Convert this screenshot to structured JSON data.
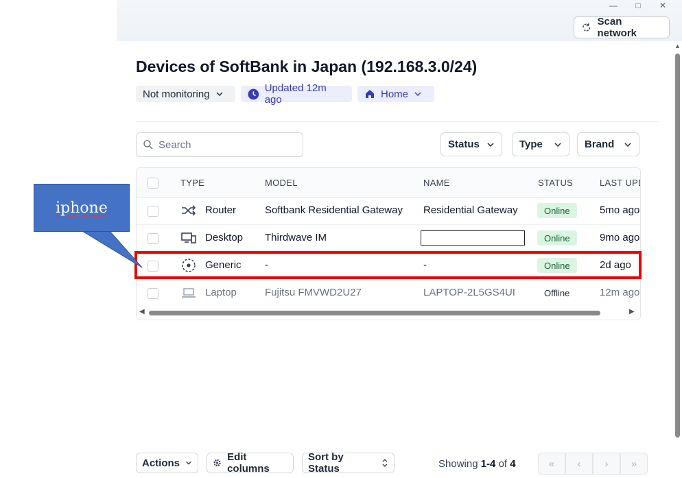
{
  "window": {
    "minimize_glyph": "—",
    "maximize_glyph": "□",
    "close_glyph": "✕"
  },
  "header": {
    "scan_button": "Scan network"
  },
  "page": {
    "title": "Devices of SoftBank in Japan (192.168.3.0/24)",
    "monitoring": "Not monitoring",
    "updated": "Updated 12m ago",
    "location": "Home"
  },
  "filters": {
    "search_placeholder": "Search",
    "status": "Status",
    "type": "Type",
    "brand": "Brand"
  },
  "table": {
    "columns": [
      "TYPE",
      "MODEL",
      "NAME",
      "STATUS",
      "LAST UPD"
    ],
    "rows": [
      {
        "type": "Router",
        "icon": "shuffle-icon",
        "model": "Softbank Residential Gateway",
        "name": "Residential Gateway",
        "status": "Online",
        "last": "5mo ago",
        "dim": false
      },
      {
        "type": "Desktop",
        "icon": "desktop-icon",
        "model": "Thirdwave IM",
        "name": "",
        "status": "Online",
        "last": "9mo ago",
        "dim": false
      },
      {
        "type": "Generic",
        "icon": "generic-device-icon",
        "model": "-",
        "name": "-",
        "status": "Online",
        "last": "2d ago",
        "dim": false
      },
      {
        "type": "Laptop",
        "icon": "laptop-icon",
        "model": "Fujitsu FMVWD2U27",
        "name": "LAPTOP-2L5GS4UI",
        "status": "Offline",
        "last": "12m ago",
        "dim": true
      }
    ]
  },
  "footer": {
    "actions": "Actions",
    "edit_columns": "Edit columns",
    "sort": "Sort by Status",
    "showing_prefix": "Showing ",
    "showing_range": "1-4",
    "showing_mid": " of ",
    "showing_total": "4"
  },
  "annotation": {
    "callout_text": "iphone",
    "highlight_color": "#ee0000",
    "callout_color": "#4472c4"
  },
  "colors": {
    "accent": "#3a3ab8",
    "online_bg": "#dcf5e3",
    "online_text": "#166534"
  }
}
